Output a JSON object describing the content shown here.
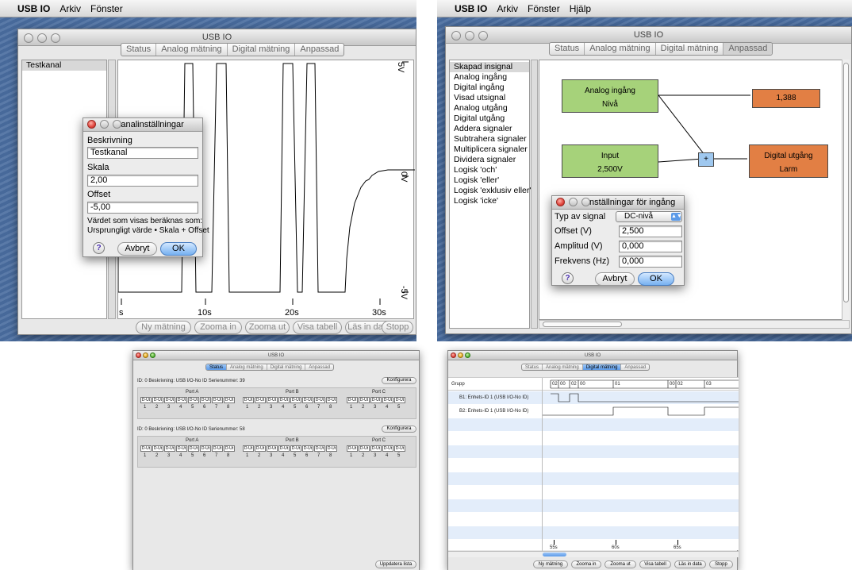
{
  "w1": {
    "menubar": {
      "app": "USB IO",
      "menus": [
        "Arkiv",
        "Fönster"
      ]
    },
    "title": "USB IO",
    "tabs": [
      "Status",
      "Analog mätning",
      "Digital mätning",
      "Anpassad"
    ],
    "channel": "Testkanal",
    "y_labels": [
      "5V",
      "0V",
      "-5V"
    ],
    "x_labels": [
      "s",
      "10s",
      "20s",
      "30s"
    ],
    "buttons": [
      "Ny mätning",
      "Zooma in",
      "Zooma ut",
      "Visa tabell",
      "Läs in data",
      "Stopp"
    ],
    "dialog": {
      "title": "Kanalinställningar",
      "desc_label": "Beskrivning",
      "desc_value": "Testkanal",
      "scale_label": "Skala",
      "scale_value": "2,00",
      "offset_label": "Offset",
      "offset_value": "-5,00",
      "formula_1": "Värdet som visas beräknas som:",
      "formula_2": "Ursprungligt värde • Skala + Offset",
      "help": "?",
      "cancel": "Avbryt",
      "ok": "OK"
    }
  },
  "w2": {
    "menubar": {
      "app": "USB IO",
      "menus": [
        "Arkiv",
        "Fönster",
        "Hjälp"
      ]
    },
    "title": "USB IO",
    "tabs": [
      "Status",
      "Analog mätning",
      "Digital mätning",
      "Anpassad"
    ],
    "list": [
      "Skapad insignal",
      "Analog ingång",
      "Digital ingång",
      "Visad utsignal",
      "Analog utgång",
      "Digital utgång",
      "Addera signaler",
      "Subtrahera signaler",
      "Multiplicera signaler",
      "Dividera signaler",
      "Logisk 'och'",
      "Logisk 'eller'",
      "Logisk 'exklusiv eller'",
      "Logisk 'icke'"
    ],
    "nodes": {
      "analog_in": "Analog ingång",
      "analog_in_sub": "Nivå",
      "out_value": "1,388",
      "input": "Input",
      "input_sub": "2,500V",
      "plus": "+",
      "digital_out": "Digital utgång",
      "digital_out_sub": "Larm"
    },
    "dialog": {
      "title": "Inställningar för ingång",
      "type_label": "Typ av signal",
      "type_value": "DC-nivå",
      "offset_label": "Offset (V)",
      "offset_value": "2,500",
      "amp_label": "Amplitud (V)",
      "amp_value": "0,000",
      "freq_label": "Frekvens (Hz)",
      "freq_value": "0,000",
      "help": "?",
      "cancel": "Avbryt",
      "ok": "OK"
    }
  },
  "w3": {
    "title": "USB IO",
    "tabs": [
      "Status",
      "Analog mätning",
      "Digital mätning",
      "Anpassad"
    ],
    "dev1": "ID: 0 Beskrivning: USB I/O-No ID Serienummer: 39",
    "dev2": "ID: 0 Beskrivning: USB I/O-No ID Serienummer: 58",
    "configure": "Konfigurera",
    "ports": [
      "Port A",
      "Port B",
      "Port C"
    ],
    "cell": "D-Ut",
    "portA_nums": [
      "1",
      "2",
      "3",
      "4",
      "5",
      "6",
      "7",
      "8"
    ],
    "portB_nums": [
      "1",
      "2",
      "3",
      "4",
      "5",
      "6",
      "7",
      "8"
    ],
    "portC_nums": [
      "1",
      "2",
      "3",
      "4",
      "5"
    ],
    "update": "Uppdatera lista"
  },
  "w4": {
    "title": "USB IO",
    "tabs": [
      "Status",
      "Analog mätning",
      "Digital mätning",
      "Anpassad"
    ],
    "group": "Grupp",
    "rows": [
      "B1: Enhets-ID 1 (USB I/O-No ID)",
      "B2: Enhets-ID 1 (USB I/O-No ID)"
    ],
    "bus_values": [
      "02",
      "00",
      "02",
      "00",
      "01",
      "00",
      "02",
      "03"
    ],
    "x_labels": [
      "55s",
      "60s",
      "65s"
    ],
    "buttons": [
      "Ny mätning",
      "Zooma in",
      "Zooma ut",
      "Visa tabell",
      "Läs in data",
      "Stopp"
    ]
  }
}
